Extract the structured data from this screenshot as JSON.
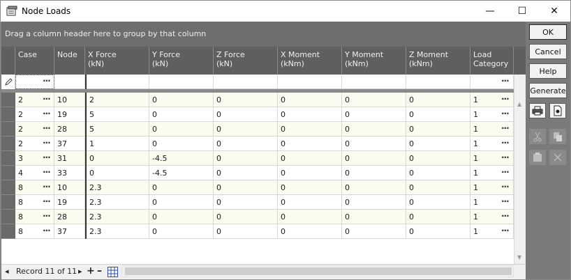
{
  "window": {
    "title": "Node Loads",
    "minimize": "—",
    "maximize": "☐",
    "close": "✕"
  },
  "group_panel": {
    "text": "Drag a column header here to group by that column"
  },
  "columns": [
    {
      "label": "Case"
    },
    {
      "label": "Node"
    },
    {
      "label": "X Force\n(kN)"
    },
    {
      "label": "Y Force\n(kN)"
    },
    {
      "label": "Z Force\n(kN)"
    },
    {
      "label": "X Moment\n(kNm)"
    },
    {
      "label": "Y Moment\n(kNm)"
    },
    {
      "label": "Z Moment\n(kNm)"
    },
    {
      "label": "Load\nCategory"
    }
  ],
  "rows": [
    [
      "2",
      "10",
      "2",
      "0",
      "0",
      "0",
      "0",
      "0",
      "1"
    ],
    [
      "2",
      "19",
      "5",
      "0",
      "0",
      "0",
      "0",
      "0",
      "1"
    ],
    [
      "2",
      "28",
      "5",
      "0",
      "0",
      "0",
      "0",
      "0",
      "1"
    ],
    [
      "2",
      "37",
      "1",
      "0",
      "0",
      "0",
      "0",
      "0",
      "1"
    ],
    [
      "3",
      "31",
      "0",
      "-4.5",
      "0",
      "0",
      "0",
      "0",
      "1"
    ],
    [
      "4",
      "33",
      "0",
      "-4.5",
      "0",
      "0",
      "0",
      "0",
      "1"
    ],
    [
      "8",
      "10",
      "2.3",
      "0",
      "0",
      "0",
      "0",
      "0",
      "1"
    ],
    [
      "8",
      "19",
      "2.3",
      "0",
      "0",
      "0",
      "0",
      "0",
      "1"
    ],
    [
      "8",
      "28",
      "2.3",
      "0",
      "0",
      "0",
      "0",
      "0",
      "1"
    ],
    [
      "8",
      "37",
      "2.3",
      "0",
      "0",
      "0",
      "0",
      "0",
      "1"
    ]
  ],
  "ellipsis": "···",
  "status": {
    "record_text": "Record 11 of 11",
    "prev": "◂",
    "next": "▸",
    "add": "+",
    "remove": "–"
  },
  "buttons": {
    "ok": "OK",
    "cancel": "Cancel",
    "help": "Help",
    "generate": "Generate"
  },
  "icons": {
    "app": "node-loads-icon",
    "print": "print-icon",
    "preview": "print-preview-icon",
    "cut": "cut-icon",
    "copy": "copy-icon",
    "paste": "paste-icon",
    "delete": "delete-icon",
    "grid": "grid-icon",
    "edit": "pencil-icon"
  },
  "colors": {
    "header_bg": "#5f5f5f",
    "row_alt": "#fbfbf0",
    "row": "#ffffff",
    "panel_bg": "#7a7a7a"
  }
}
